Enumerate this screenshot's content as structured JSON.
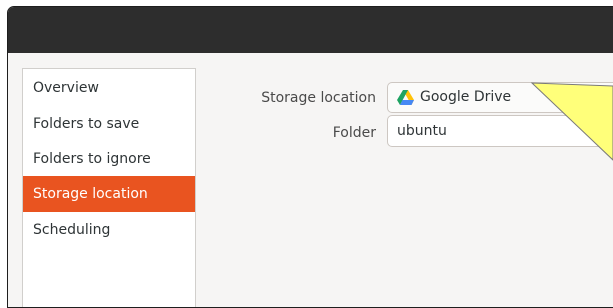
{
  "sidebar": {
    "items": [
      {
        "label": "Overview"
      },
      {
        "label": "Folders to save"
      },
      {
        "label": "Folders to ignore"
      },
      {
        "label": "Storage location",
        "active": true
      },
      {
        "label": "Scheduling"
      }
    ]
  },
  "form": {
    "storage_location_label": "Storage location",
    "storage_location_value": "Google Drive",
    "storage_location_icon": "google-drive-icon",
    "folder_label": "Folder",
    "folder_value": "ubuntu"
  },
  "colors": {
    "titlebar": "#2d2d2d",
    "window_bg": "#f6f5f4",
    "sidebar_bg": "#ffffff",
    "active_item": "#e95420",
    "callout_fill": "#ffff7a",
    "drive_green": "#1ea362",
    "drive_blue": "#4688f4",
    "drive_yellow": "#ffc208"
  }
}
